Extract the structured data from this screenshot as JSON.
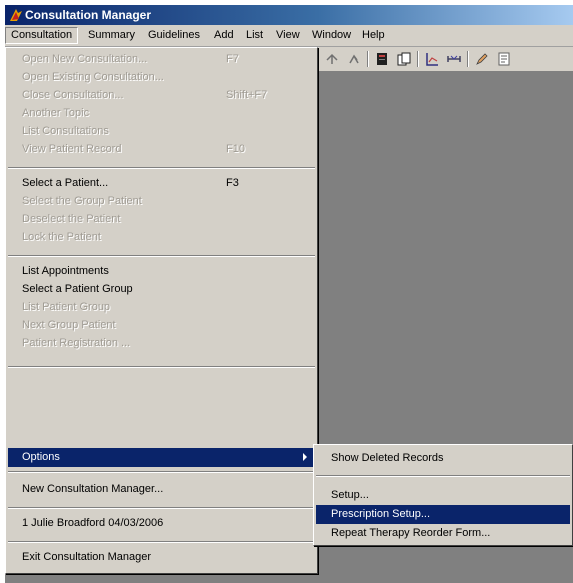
{
  "window": {
    "title": "Consultation Manager"
  },
  "menubar": {
    "items": [
      {
        "label": "Consultation"
      },
      {
        "label": "Summary"
      },
      {
        "label": "Guidelines"
      },
      {
        "label": "Add"
      },
      {
        "label": "List"
      },
      {
        "label": "View"
      },
      {
        "label": "Window"
      },
      {
        "label": "Help"
      }
    ]
  },
  "menu": {
    "items": [
      {
        "label": "Open New Consultation...",
        "shortcut": "F7",
        "enabled": false
      },
      {
        "label": "Open Existing Consultation...",
        "shortcut": "",
        "enabled": false
      },
      {
        "label": "Close Consultation...",
        "shortcut": "Shift+F7",
        "enabled": false
      },
      {
        "label": "Another Topic",
        "shortcut": "",
        "enabled": false
      },
      {
        "label": "List Consultations",
        "shortcut": "",
        "enabled": false
      },
      {
        "label": "View Patient Record",
        "shortcut": "F10",
        "enabled": false
      },
      {
        "label": "Select a Patient...",
        "shortcut": "F3",
        "enabled": true
      },
      {
        "label": "Select the Group Patient",
        "shortcut": "",
        "enabled": false
      },
      {
        "label": "Deselect the Patient",
        "shortcut": "",
        "enabled": false
      },
      {
        "label": "Lock the Patient",
        "shortcut": "",
        "enabled": false
      },
      {
        "label": "List Appointments",
        "shortcut": "",
        "enabled": true
      },
      {
        "label": "Select a Patient Group",
        "shortcut": "",
        "enabled": true
      },
      {
        "label": "List Patient Group",
        "shortcut": "",
        "enabled": false
      },
      {
        "label": "Next Group Patient",
        "shortcut": "",
        "enabled": false
      },
      {
        "label": "Patient Registration ...",
        "shortcut": "",
        "enabled": false
      },
      {
        "label": "Options",
        "shortcut": "",
        "enabled": true,
        "selected": true
      },
      {
        "label": "New Consultation Manager...",
        "shortcut": "",
        "enabled": true
      },
      {
        "label": "1 Julie Broadford 04/03/2006",
        "shortcut": "",
        "enabled": true
      },
      {
        "label": "Exit Consultation Manager",
        "shortcut": "",
        "enabled": true
      }
    ]
  },
  "submenu": {
    "items": [
      {
        "label": "Show Deleted Records"
      },
      {
        "label": "Setup..."
      },
      {
        "label": "Prescription Setup...",
        "selected": true
      },
      {
        "label": "Repeat Therapy Reorder Form..."
      }
    ]
  },
  "colors": {
    "menu_background": "#d4d0c8",
    "highlight": "#0a246a",
    "disabled_text": "#a09c94",
    "workspace": "#808080"
  }
}
